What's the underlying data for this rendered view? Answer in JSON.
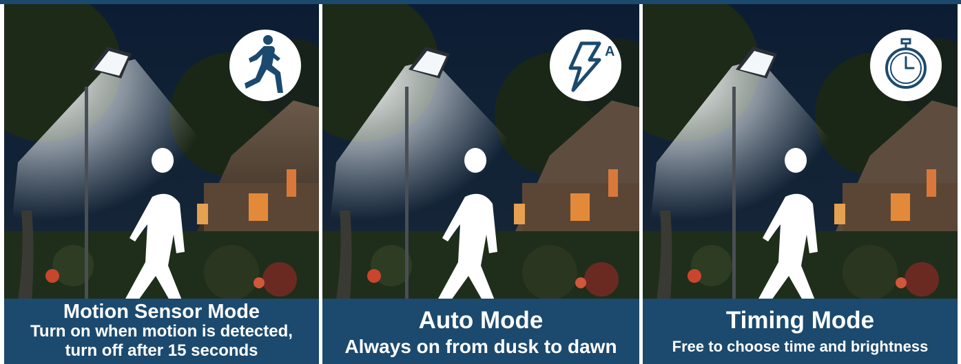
{
  "panels": [
    {
      "icon": "running-person-icon",
      "title": "Motion Sensor Mode",
      "line1": "Turn on when motion is detected,",
      "line2": "turn off after 15 seconds"
    },
    {
      "icon": "auto-lightning-icon",
      "icon_letter": "A",
      "title": "Auto Mode",
      "line1": "Always on from dusk to dawn"
    },
    {
      "icon": "stopwatch-icon",
      "title": "Timing Mode",
      "line1": "Free to choose time and brightness"
    }
  ],
  "colors": {
    "caption_bg": "#1c4a6e",
    "icon_color": "#1c4a6e",
    "caption_text": "#ffffff"
  }
}
